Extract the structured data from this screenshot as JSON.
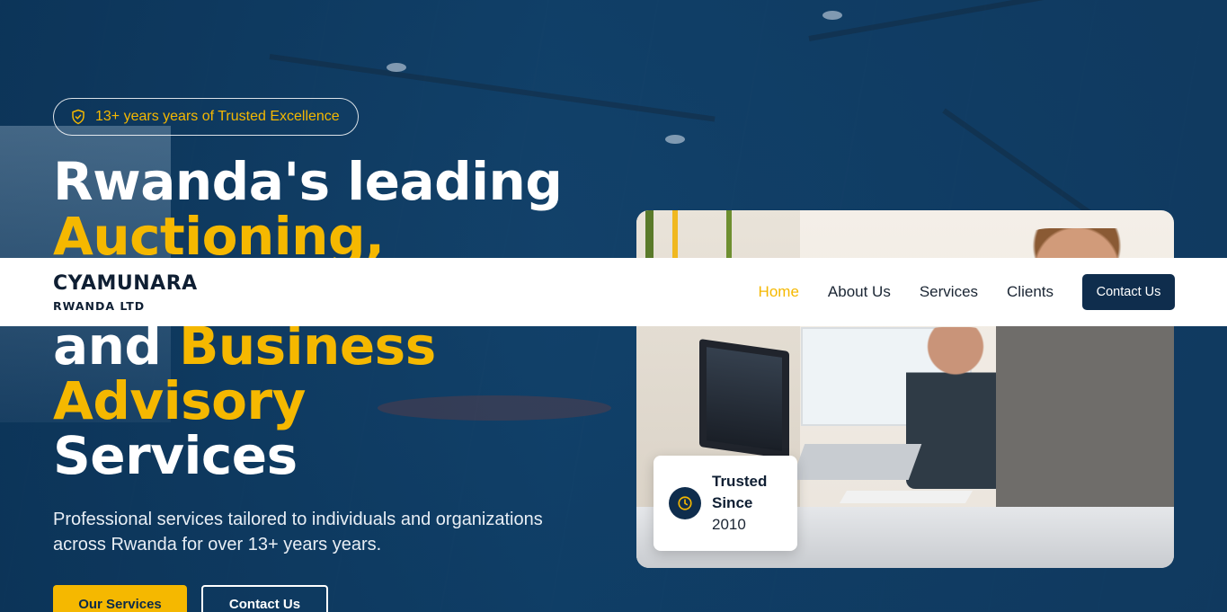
{
  "hero": {
    "badge_text": "13+ years years of Trusted Excellence",
    "headline": {
      "line1": "Rwanda's leading",
      "line2": "Auctioning,",
      "line4_prefix": "and ",
      "line4_accent": "Business",
      "line5": "Advisory",
      "line6": "Services"
    },
    "subtitle": "Professional services tailored to individuals and organizations across Rwanda for over 13+ years years.",
    "primary_button": "Our Services",
    "secondary_button": "Contact Us",
    "trusted_card": {
      "title": "Trusted Since",
      "year": "2010"
    }
  },
  "navbar": {
    "logo_name": "CYAMUNARA",
    "logo_sub": "RWANDA LTD",
    "links": [
      "Home",
      "About Us",
      "Services",
      "Clients"
    ],
    "active_link": "Home",
    "contact_button": "Contact Us"
  },
  "colors": {
    "accent": "#f5b800",
    "navy": "#0f2d4d",
    "hero_overlay": "#10395f"
  },
  "icons": {
    "badge": "shield-check-icon",
    "trusted": "clock-icon"
  }
}
